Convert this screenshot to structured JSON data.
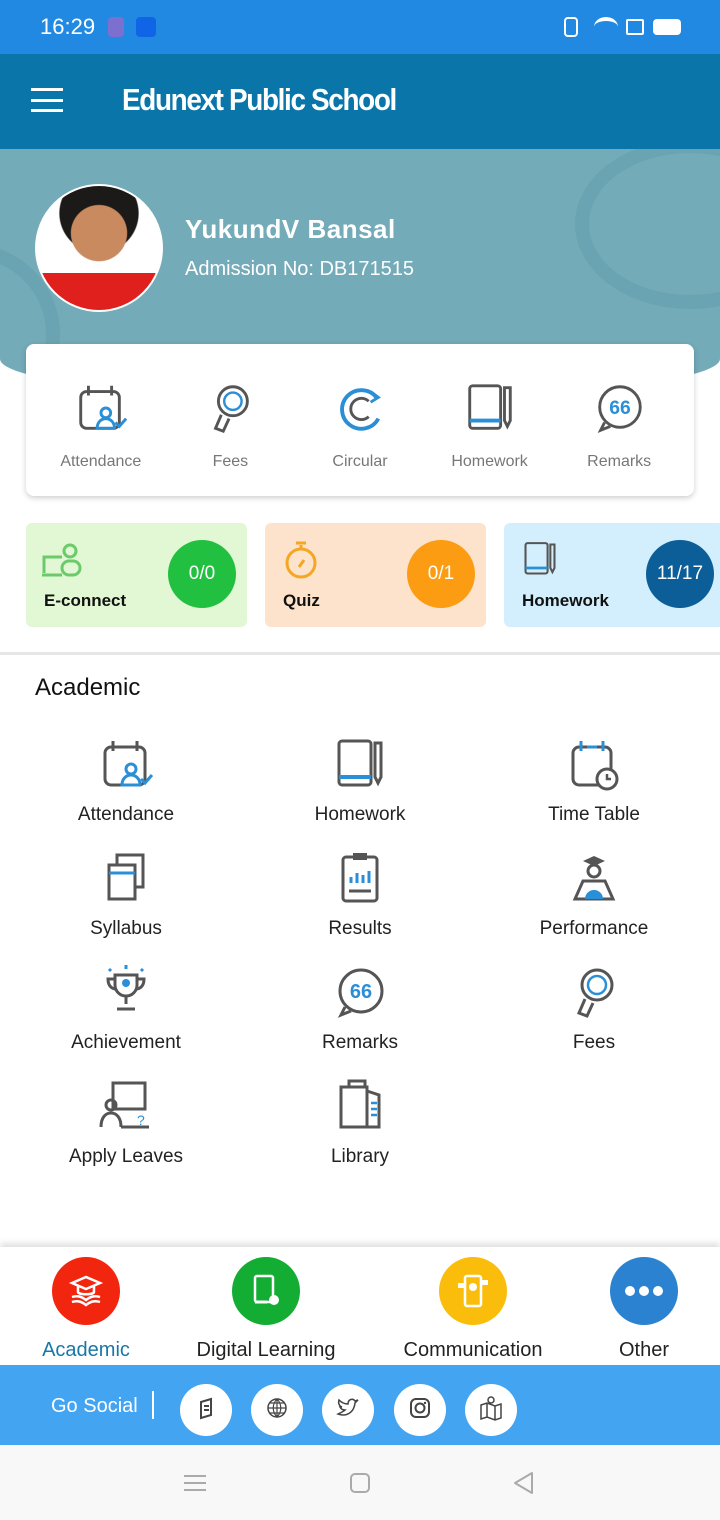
{
  "status_bar": {
    "time": "16:29"
  },
  "app_bar": {
    "title": "Edunext Public School"
  },
  "profile": {
    "name": "YukundV Bansal",
    "admission": "Admission No: DB171515"
  },
  "quick_actions": [
    {
      "label": "Attendance",
      "icon": "attendance-icon"
    },
    {
      "label": "Fees",
      "icon": "fees-icon"
    },
    {
      "label": "Circular",
      "icon": "circular-icon"
    },
    {
      "label": "Homework",
      "icon": "homework-icon"
    },
    {
      "label": "Remarks",
      "icon": "remarks-icon"
    }
  ],
  "tiles": [
    {
      "label": "E-connect",
      "count": "0/0",
      "bg": "#e2f7d3",
      "accent": "#22c040",
      "icon": "econnect-icon"
    },
    {
      "label": "Quiz",
      "count": "0/1",
      "bg": "#fde3cc",
      "accent": "#fb9c12",
      "icon": "stopwatch-icon"
    },
    {
      "label": "Homework",
      "count": "11/17",
      "bg": "#d3eefc",
      "accent": "#0b5e98",
      "icon": "homework-icon"
    }
  ],
  "academic": {
    "title": "Academic",
    "items": [
      {
        "label": "Attendance",
        "icon": "attendance-icon"
      },
      {
        "label": "Homework",
        "icon": "homework-icon"
      },
      {
        "label": "Time Table",
        "icon": "timetable-icon"
      },
      {
        "label": "Syllabus",
        "icon": "syllabus-icon"
      },
      {
        "label": "Results",
        "icon": "results-icon"
      },
      {
        "label": "Performance",
        "icon": "performance-icon"
      },
      {
        "label": "Achievement",
        "icon": "trophy-icon"
      },
      {
        "label": "Remarks",
        "icon": "remarks-icon"
      },
      {
        "label": "Fees",
        "icon": "fees-icon"
      },
      {
        "label": "Apply Leaves",
        "icon": "leave-icon"
      },
      {
        "label": "Library",
        "icon": "library-icon"
      }
    ]
  },
  "bottom_nav": [
    {
      "label": "Academic",
      "active": true,
      "color": "#f2260f"
    },
    {
      "label": "Digital Learning",
      "color": "#13ad33"
    },
    {
      "label": "Communication",
      "color": "#fbbd0c"
    },
    {
      "label": "Other",
      "color": "#2a82d0"
    }
  ],
  "colors": {
    "active_nav": "#1778a8"
  },
  "social": {
    "label": "Go Social",
    "icons": [
      "blog-icon",
      "globe-icon",
      "twitter-icon",
      "instagram-icon",
      "map-icon"
    ]
  }
}
